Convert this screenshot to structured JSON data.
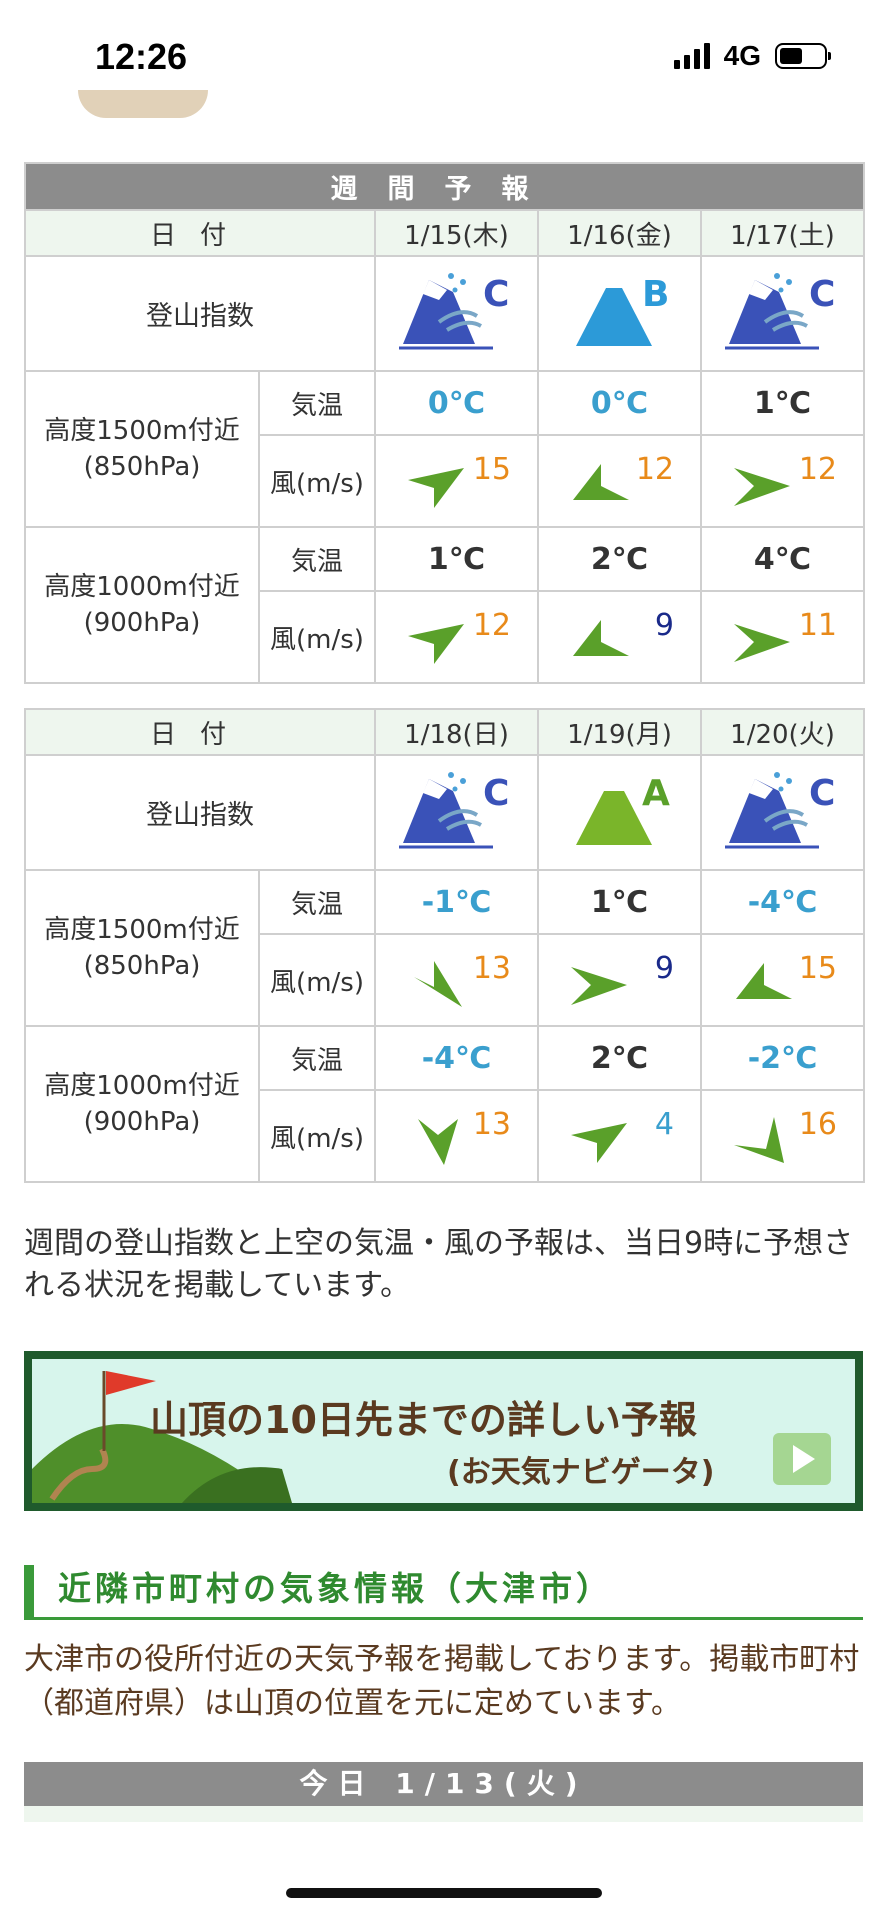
{
  "status": {
    "time": "12:26",
    "network": "4G"
  },
  "weekly": {
    "header": "週間予報",
    "date_label": "日付",
    "index_label": "登山指数",
    "temp_label": "気温",
    "wind_label": "風(m/s)",
    "levels": [
      {
        "line1": "高度1500m付近",
        "line2": "(850hPa)"
      },
      {
        "line1": "高度1000m付近",
        "line2": "(900hPa)"
      }
    ],
    "blocks": [
      {
        "days": [
          {
            "date": "1/15(木)",
            "index": "C",
            "icon": "mountain-snow-wind-icon",
            "t1500": "0℃",
            "w1500": "15",
            "t1000": "1℃",
            "w1000": "12"
          },
          {
            "date": "1/16(金)",
            "index": "B",
            "icon": "mountain-blue-icon",
            "t1500": "0℃",
            "w1500": "12",
            "t1000": "2℃",
            "w1000": "9"
          },
          {
            "date": "1/17(土)",
            "index": "C",
            "icon": "mountain-snow-wind-icon",
            "t1500": "1℃",
            "w1500": "12",
            "t1000": "4℃",
            "w1000": "11"
          }
        ]
      },
      {
        "days": [
          {
            "date": "1/18(日)",
            "index": "C",
            "icon": "mountain-snow-wind-icon",
            "t1500": "-1℃",
            "w1500": "13",
            "t1000": "-4℃",
            "w1000": "13"
          },
          {
            "date": "1/19(月)",
            "index": "A",
            "icon": "mountain-green-icon",
            "t1500": "1℃",
            "w1500": "9",
            "t1000": "2℃",
            "w1000": "4"
          },
          {
            "date": "1/20(火)",
            "index": "C",
            "icon": "mountain-snow-wind-icon",
            "t1500": "-4℃",
            "w1500": "15",
            "t1000": "-2℃",
            "w1000": "16"
          }
        ]
      }
    ]
  },
  "note": "週間の登山指数と上空の気温・風の予報は、当日9時に予想される状況を掲載しています。",
  "banner": {
    "title": "山頂の10日先までの詳しい予報",
    "subtitle": "(お天気ナビゲータ)"
  },
  "nearby": {
    "heading": "近隣市町村の気象情報（大津市）",
    "body": "大津市の役所付近の天気予報を掲載しております。掲載市町村（都道府県）は山頂の位置を元に定めています。"
  },
  "today": {
    "header": "今日 1/13(火)"
  },
  "colors": {
    "accent_green": "#3a9a3a",
    "temp_cold": "#3a9fce",
    "wind_value": "#e88a1a",
    "header_gray": "#8c8c8c"
  }
}
